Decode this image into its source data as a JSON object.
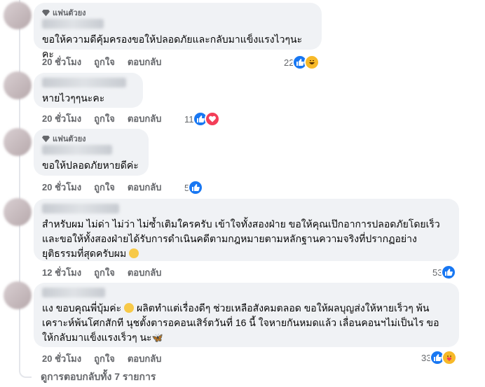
{
  "fan_badge_label": "แฟนตัวยง",
  "comments": [
    {
      "text": "ขอให้ความดีคุ้มครองขอให้ปลอดภัยและกลับมาแข็งแรงไวๆนะคะ",
      "time": "20 ชั่วโมง",
      "like": "ถูกใจ",
      "reply": "ตอบกลับ",
      "reaction_count": "22",
      "reactions": [
        "like-icon",
        "haha-icon"
      ]
    },
    {
      "text": "หายไวๆๆนะคะ",
      "time": "20 ชั่วโมง",
      "like": "ถูกใจ",
      "reply": "ตอบกลับ",
      "reaction_count": "11",
      "reactions": [
        "like-icon",
        "love-icon"
      ]
    },
    {
      "text": "ขอให้ปลอดภัยหายดีค่ะ",
      "time": "20 ชั่วโมง",
      "like": "ถูกใจ",
      "reply": "ตอบกลับ",
      "reaction_count": "5",
      "reactions": [
        "like-icon"
      ]
    },
    {
      "line1": "สำหรับผม ไม่ด่า ไม่ว่า ไม่ซ้ำเติมใครครับ เข้าใจทั้งสองฝ่าย ขอให้คุณเป๊กอาการปลอดภัยโดยเร็ว",
      "line2": "และขอให้ทั้งสองฝ่ายได้รับการดำเนินคดีตามกฎหมายตามหลักฐานความจริงที่ปรากฏอย่าง",
      "line3": "ยุติธรรมที่สุดครับผม",
      "time": "12 ชั่วโมง",
      "like": "ถูกใจ",
      "reply": "ตอบกลับ",
      "reaction_count": "53",
      "reactions": [
        "like-icon"
      ]
    },
    {
      "line1a": "แง ขอบคุณพี่บุ้มค่ะ",
      "line1b": "ผลิตทำแต่เรื่องดีๆ ช่วยเหลือสังคมตลอด ขอให้ผลบุญส่งให้หายเร็วๆ พ้น",
      "line2": "เคราะห์พ้นโศกสักที นุชตั้งตารอคอนเสิร์ตวันที่ 16 นี้ ใจหายกันหมดแล้ว เลื่อนคอนฯไม่เป็นไร ขอ",
      "line3": "ให้กลับมาแข็งแรงเร็วๆ นะ",
      "time": "20 ชั่วโมง",
      "like": "ถูกใจ",
      "reply": "ตอบกลับ",
      "reaction_count": "33",
      "reactions": [
        "like-icon",
        "care-icon"
      ]
    }
  ],
  "view_more": "ดูการตอบกลับทั้ง 7 รายการ",
  "colors": {
    "bubble": "#f0f2f5",
    "meta": "#65676b",
    "like": "#1877f2",
    "love": "#f33e58",
    "haha": "#f7b928"
  }
}
